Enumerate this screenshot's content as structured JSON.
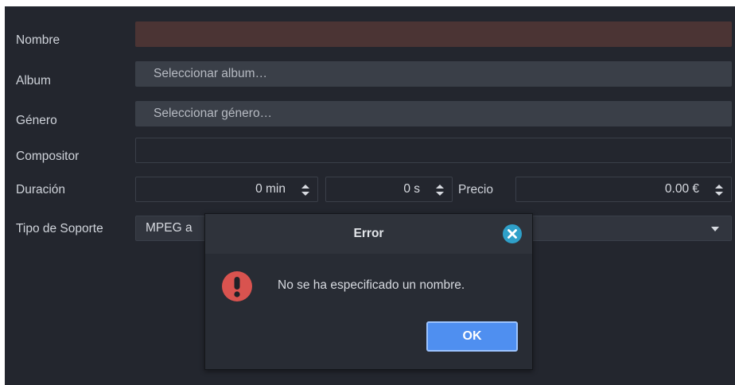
{
  "form": {
    "name_label": "Nombre",
    "name_value": "",
    "album_label": "Album",
    "album_placeholder": "Seleccionar album…",
    "genre_label": "Género",
    "genre_placeholder": "Seleccionar género…",
    "composer_label": "Compositor",
    "composer_value": "",
    "duration_label": "Duración",
    "duration_minutes": "0 min",
    "duration_seconds": "0 s",
    "price_label": "Precio",
    "price_value": "0.00 €",
    "media_type_label": "Tipo de Soporte",
    "media_type_value": "MPEG a"
  },
  "dialog": {
    "title": "Error",
    "message": "No se ha especificado un nombre.",
    "ok_label": "OK",
    "icon": "error-exclamation-icon"
  },
  "colors": {
    "background": "#23262e",
    "error_field": "#4b3434",
    "accent": "#4f8ff0",
    "error_icon": "#d9534f",
    "close_icon": "#2fa0c9"
  }
}
